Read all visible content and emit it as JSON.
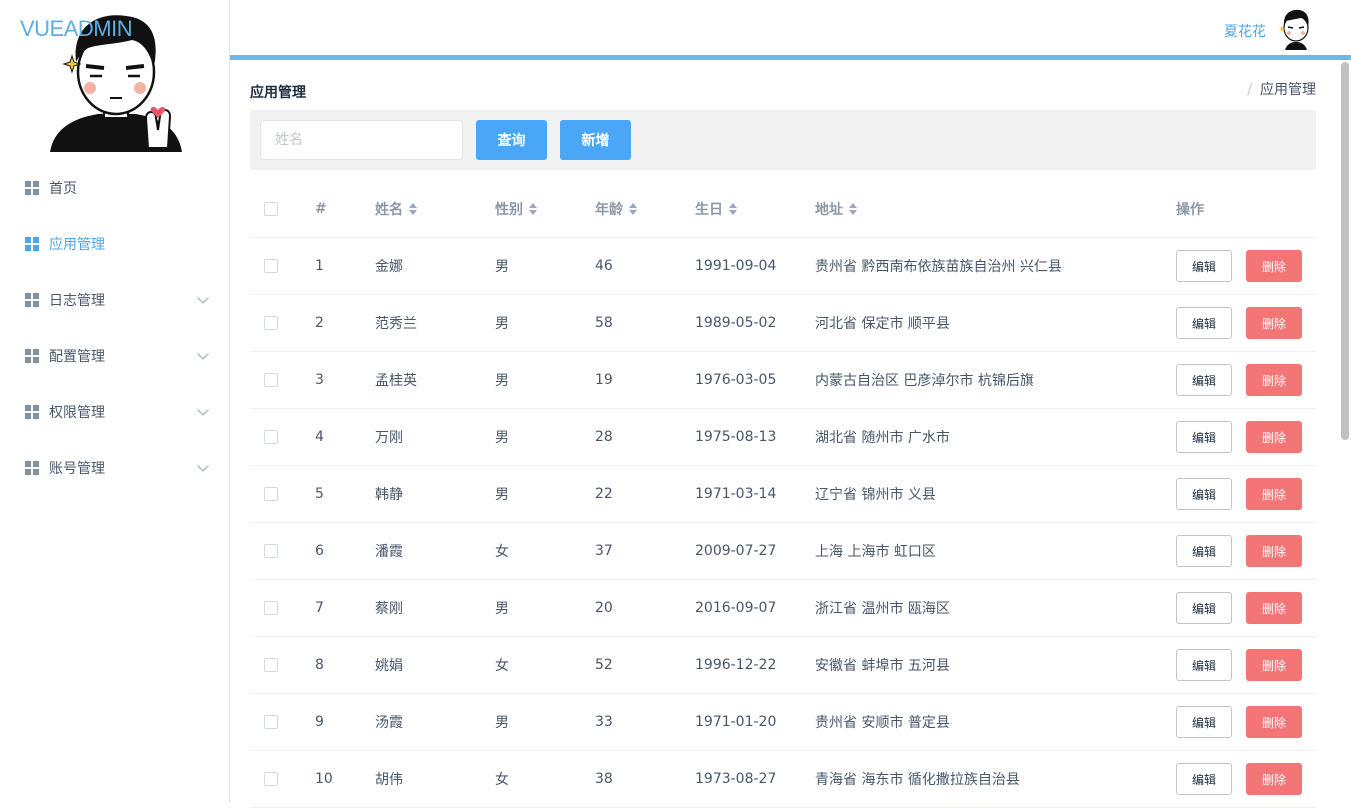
{
  "app": {
    "logo": "VUEADMIN"
  },
  "header": {
    "username": "夏花花"
  },
  "sidebar": {
    "items": [
      {
        "label": "首页",
        "active": false,
        "expandable": false
      },
      {
        "label": "应用管理",
        "active": true,
        "expandable": false
      },
      {
        "label": "日志管理",
        "active": false,
        "expandable": true
      },
      {
        "label": "配置管理",
        "active": false,
        "expandable": true
      },
      {
        "label": "权限管理",
        "active": false,
        "expandable": true
      },
      {
        "label": "账号管理",
        "active": false,
        "expandable": true
      }
    ]
  },
  "page": {
    "title": "应用管理",
    "breadcrumb": {
      "separator": "/",
      "current": "应用管理"
    }
  },
  "toolbar": {
    "search_placeholder": "姓名",
    "search_value": "",
    "query_label": "查询",
    "add_label": "新增"
  },
  "table": {
    "columns": {
      "index": "#",
      "name": "姓名",
      "sex": "性别",
      "age": "年龄",
      "birth": "生日",
      "address": "地址",
      "ops": "操作"
    },
    "edit_label": "编辑",
    "delete_label": "删除",
    "rows": [
      {
        "index": "1",
        "name": "金娜",
        "sex": "男",
        "age": "46",
        "birth": "1991-09-04",
        "address": "贵州省 黔西南布依族苗族自治州 兴仁县"
      },
      {
        "index": "2",
        "name": "范秀兰",
        "sex": "男",
        "age": "58",
        "birth": "1989-05-02",
        "address": "河北省 保定市 顺平县"
      },
      {
        "index": "3",
        "name": "孟桂英",
        "sex": "男",
        "age": "19",
        "birth": "1976-03-05",
        "address": "内蒙古自治区 巴彦淖尔市 杭锦后旗"
      },
      {
        "index": "4",
        "name": "万刚",
        "sex": "男",
        "age": "28",
        "birth": "1975-08-13",
        "address": "湖北省 随州市 广水市"
      },
      {
        "index": "5",
        "name": "韩静",
        "sex": "男",
        "age": "22",
        "birth": "1971-03-14",
        "address": "辽宁省 锦州市 义县"
      },
      {
        "index": "6",
        "name": "潘霞",
        "sex": "女",
        "age": "37",
        "birth": "2009-07-27",
        "address": "上海 上海市 虹口区"
      },
      {
        "index": "7",
        "name": "蔡刚",
        "sex": "男",
        "age": "20",
        "birth": "2016-09-07",
        "address": "浙江省 温州市 瓯海区"
      },
      {
        "index": "8",
        "name": "姚娟",
        "sex": "女",
        "age": "52",
        "birth": "1996-12-22",
        "address": "安徽省 蚌埠市 五河县"
      },
      {
        "index": "9",
        "name": "汤霞",
        "sex": "男",
        "age": "33",
        "birth": "1971-01-20",
        "address": "贵州省 安顺市 普定县"
      },
      {
        "index": "10",
        "name": "胡伟",
        "sex": "女",
        "age": "38",
        "birth": "1973-08-27",
        "address": "青海省 海东市 循化撒拉族自治县"
      }
    ]
  },
  "colors": {
    "accent": "#4aa7f7",
    "danger": "#f47575",
    "header_bar": "#68b9ec",
    "logo": "#5ab0e6"
  }
}
